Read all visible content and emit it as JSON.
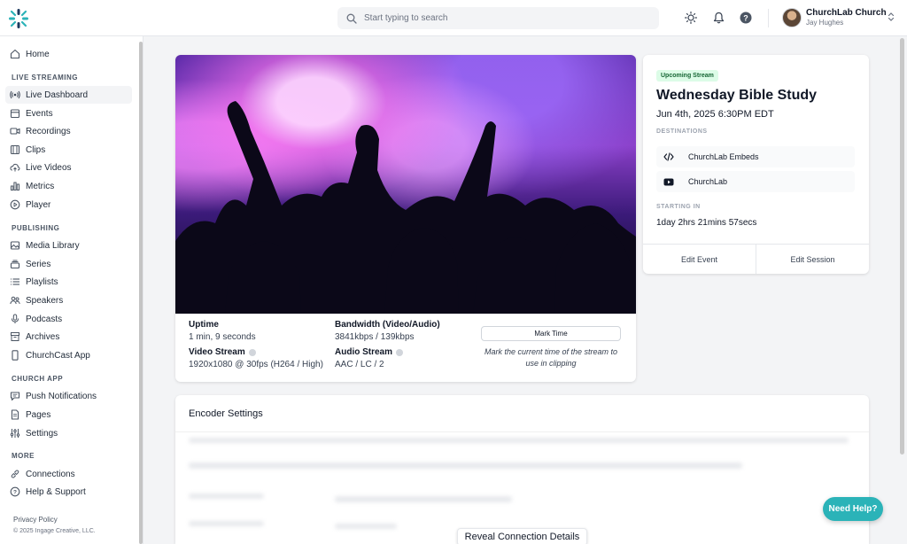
{
  "header": {
    "search_placeholder": "Start typing to search",
    "org_name": "ChurchLab Church",
    "user_name": "Jay Hughes"
  },
  "sidebar": {
    "home": "Home",
    "sections": {
      "live_streaming": "LIVE STREAMING",
      "publishing": "PUBLISHING",
      "church_app": "CHURCH APP",
      "more": "MORE"
    },
    "live_streaming_items": [
      {
        "label": "Live Dashboard",
        "icon": "broadcast-icon",
        "active": true
      },
      {
        "label": "Events",
        "icon": "calendar-icon"
      },
      {
        "label": "Recordings",
        "icon": "video-camera-icon"
      },
      {
        "label": "Clips",
        "icon": "film-icon"
      },
      {
        "label": "Live Videos",
        "icon": "cloud-upload-icon"
      },
      {
        "label": "Metrics",
        "icon": "bar-chart-icon"
      },
      {
        "label": "Player",
        "icon": "play-circle-icon"
      }
    ],
    "publishing_items": [
      {
        "label": "Media Library",
        "icon": "photo-icon"
      },
      {
        "label": "Series",
        "icon": "stack-icon"
      },
      {
        "label": "Playlists",
        "icon": "list-icon"
      },
      {
        "label": "Speakers",
        "icon": "users-icon"
      },
      {
        "label": "Podcasts",
        "icon": "microphone-icon"
      },
      {
        "label": "Archives",
        "icon": "archive-icon"
      },
      {
        "label": "ChurchCast App",
        "icon": "phone-icon"
      }
    ],
    "church_app_items": [
      {
        "label": "Push Notifications",
        "icon": "chat-icon"
      },
      {
        "label": "Pages",
        "icon": "document-icon"
      },
      {
        "label": "Settings",
        "icon": "sliders-icon"
      }
    ],
    "more_items": [
      {
        "label": "Connections",
        "icon": "link-icon"
      },
      {
        "label": "Help & Support",
        "icon": "question-circle-icon"
      }
    ],
    "privacy": "Privacy Policy",
    "copyright": "© 2025 Ingage Creative, LLC."
  },
  "stream": {
    "uptime_label": "Uptime",
    "uptime_value": "1 min, 9 seconds",
    "bandwidth_label": "Bandwidth (Video/Audio)",
    "bandwidth_value": "3841kbps / 139kbps",
    "video_stream_label": "Video Stream",
    "video_stream_value": "1920x1080 @ 30fps (H264 / High)",
    "audio_stream_label": "Audio Stream",
    "audio_stream_value": "AAC / LC / 2",
    "mark_time_label": "Mark Time",
    "mark_time_help": "Mark the current time of the stream to use in clipping"
  },
  "upcoming": {
    "badge": "Upcoming Stream",
    "title": "Wednesday Bible Study",
    "date": "Jun 4th, 2025 6:30PM EDT",
    "destinations_label": "DESTINATIONS",
    "destinations": [
      "ChurchLab Embeds",
      "ChurchLab"
    ],
    "starting_in_label": "STARTING IN",
    "countdown": "1day 2hrs 21mins 57secs",
    "edit_event": "Edit Event",
    "edit_session": "Edit Session"
  },
  "encoder": {
    "title": "Encoder Settings",
    "reveal": "Reveal Connection Details"
  },
  "help": "Need Help?",
  "colors": {
    "accent": "#2bb3b8",
    "badge_bg": "#dcfce7",
    "badge_text": "#166534"
  }
}
